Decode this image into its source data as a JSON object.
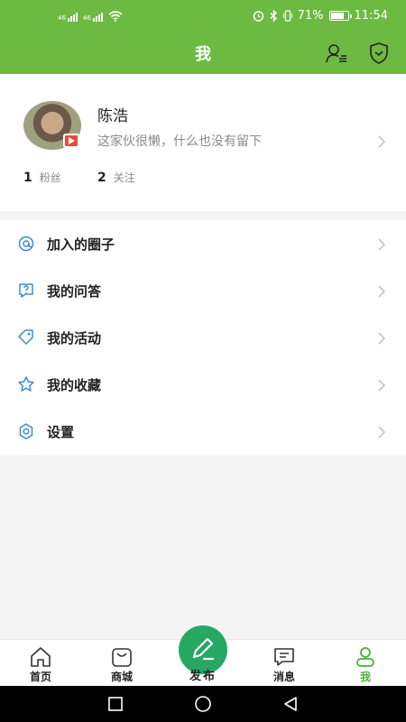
{
  "status_bar": {
    "signal1": "46",
    "signal2": "46",
    "battery_percent": "71%",
    "time": "11:54"
  },
  "header": {
    "title": "我"
  },
  "profile": {
    "name": "陈浩",
    "bio": "这家伙很懒，什么也没有留下",
    "followers_count": "1",
    "followers_label": "粉丝",
    "following_count": "2",
    "following_label": "关注"
  },
  "menu": {
    "items": [
      {
        "label": "加入的圈子",
        "icon": "circle-icon"
      },
      {
        "label": "我的问答",
        "icon": "qa-icon"
      },
      {
        "label": "我的活动",
        "icon": "tag-icon"
      },
      {
        "label": "我的收藏",
        "icon": "star-icon"
      },
      {
        "label": "设置",
        "icon": "settings-icon"
      }
    ]
  },
  "tabbar": {
    "home": "首页",
    "mall": "商城",
    "publish": "发布",
    "messages": "消息",
    "me": "我"
  },
  "colors": {
    "brand_green": "#6dba43",
    "publish_green": "#26a862",
    "active_tab": "#4caf3a"
  }
}
